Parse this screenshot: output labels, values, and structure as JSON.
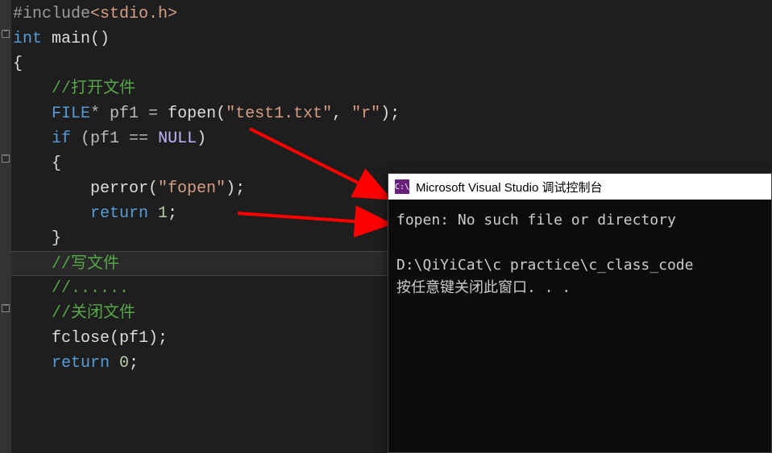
{
  "code": {
    "l1_pp": "#include",
    "l1_inc": "<stdio.h>",
    "l2_kw": "int",
    "l2_func": " main",
    "l2_punc": "()",
    "l3": "{",
    "l4_comm": "//打开文件",
    "l5_type": "FILE",
    "l5_op1": "*",
    "l5_ident": " pf1 ",
    "l5_op2": "=",
    "l5_fn": " fopen",
    "l5_p1": "(",
    "l5_s1": "\"test1.txt\"",
    "l5_c": ", ",
    "l5_s2": "\"r\"",
    "l5_p2": ");",
    "l6_kw": "if",
    "l6_p1": " (pf1 ",
    "l6_op": "==",
    "l6_null": " NULL",
    "l6_p2": ")",
    "l7": "{",
    "l8_fn": "perror",
    "l8_p1": "(",
    "l8_s": "\"fopen\"",
    "l8_p2": ");",
    "l9_kw": "return",
    "l9_num": " 1",
    "l9_p": ";",
    "l10": "}",
    "l11_comm": "//写文件",
    "l12_comm": "//......",
    "l13_comm": "//关闭文件",
    "l14_fn": "fclose",
    "l14_p1": "(pf1);",
    "l15_kw": "return",
    "l15_num": " 0",
    "l15_p": ";"
  },
  "console": {
    "icon_text": "C:\\",
    "title": "Microsoft Visual Studio 调试控制台",
    "line1": "fopen: No such file or directory",
    "line2": "D:\\QiYiCat\\c practice\\c_class_code",
    "line3": "按任意键关闭此窗口. . ."
  }
}
